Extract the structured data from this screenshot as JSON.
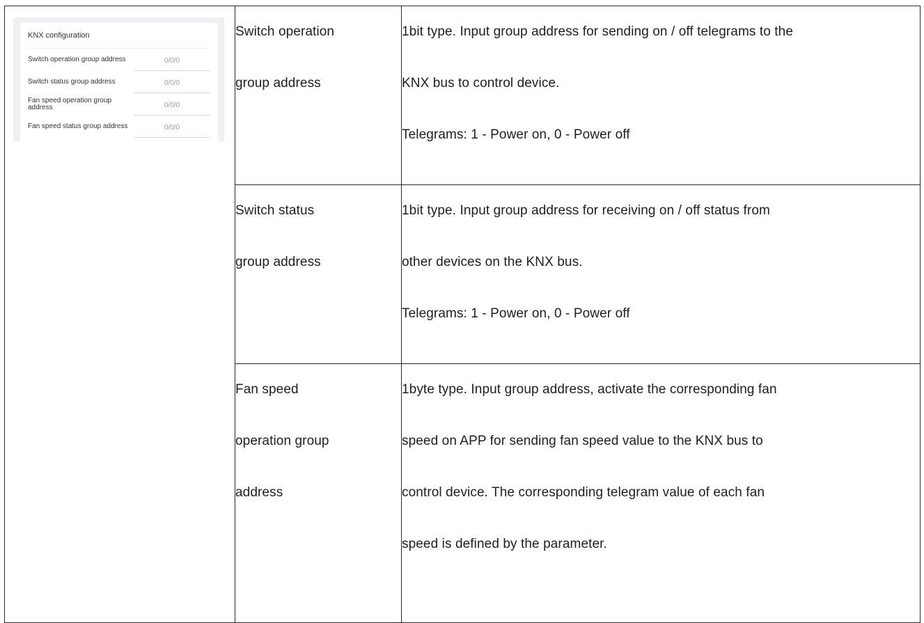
{
  "app_screenshot": {
    "title": "KNX configuration",
    "rows": [
      {
        "label": "Switch operation group address",
        "value": "0/0/0"
      },
      {
        "label": "Switch status group address",
        "value": "0/0/0"
      },
      {
        "label": "Fan speed operation group address",
        "value": "0/0/0"
      },
      {
        "label": "Fan speed status group address",
        "value": "0/0/0"
      }
    ]
  },
  "table": {
    "rows": [
      {
        "name_lines": [
          "Switch operation",
          "group address"
        ],
        "desc_lines": [
          "1bit type. Input group address for sending on / off telegrams to the",
          "KNX bus to control device.",
          "Telegrams: 1 - Power on, 0 - Power off"
        ]
      },
      {
        "name_lines": [
          "Switch status",
          "group address"
        ],
        "desc_lines": [
          "1bit type. Input group address for receiving on / off status from",
          "other devices on the KNX bus.",
          "Telegrams: 1 - Power on, 0 - Power off"
        ]
      },
      {
        "name_lines": [
          "Fan speed",
          "operation group",
          "address"
        ],
        "desc_lines": [
          "1byte type. Input group address, activate the corresponding fan",
          "speed on APP for sending fan speed value to the KNX bus to",
          "control device. The corresponding telegram value of each fan",
          "speed is defined by the parameter."
        ]
      }
    ]
  }
}
